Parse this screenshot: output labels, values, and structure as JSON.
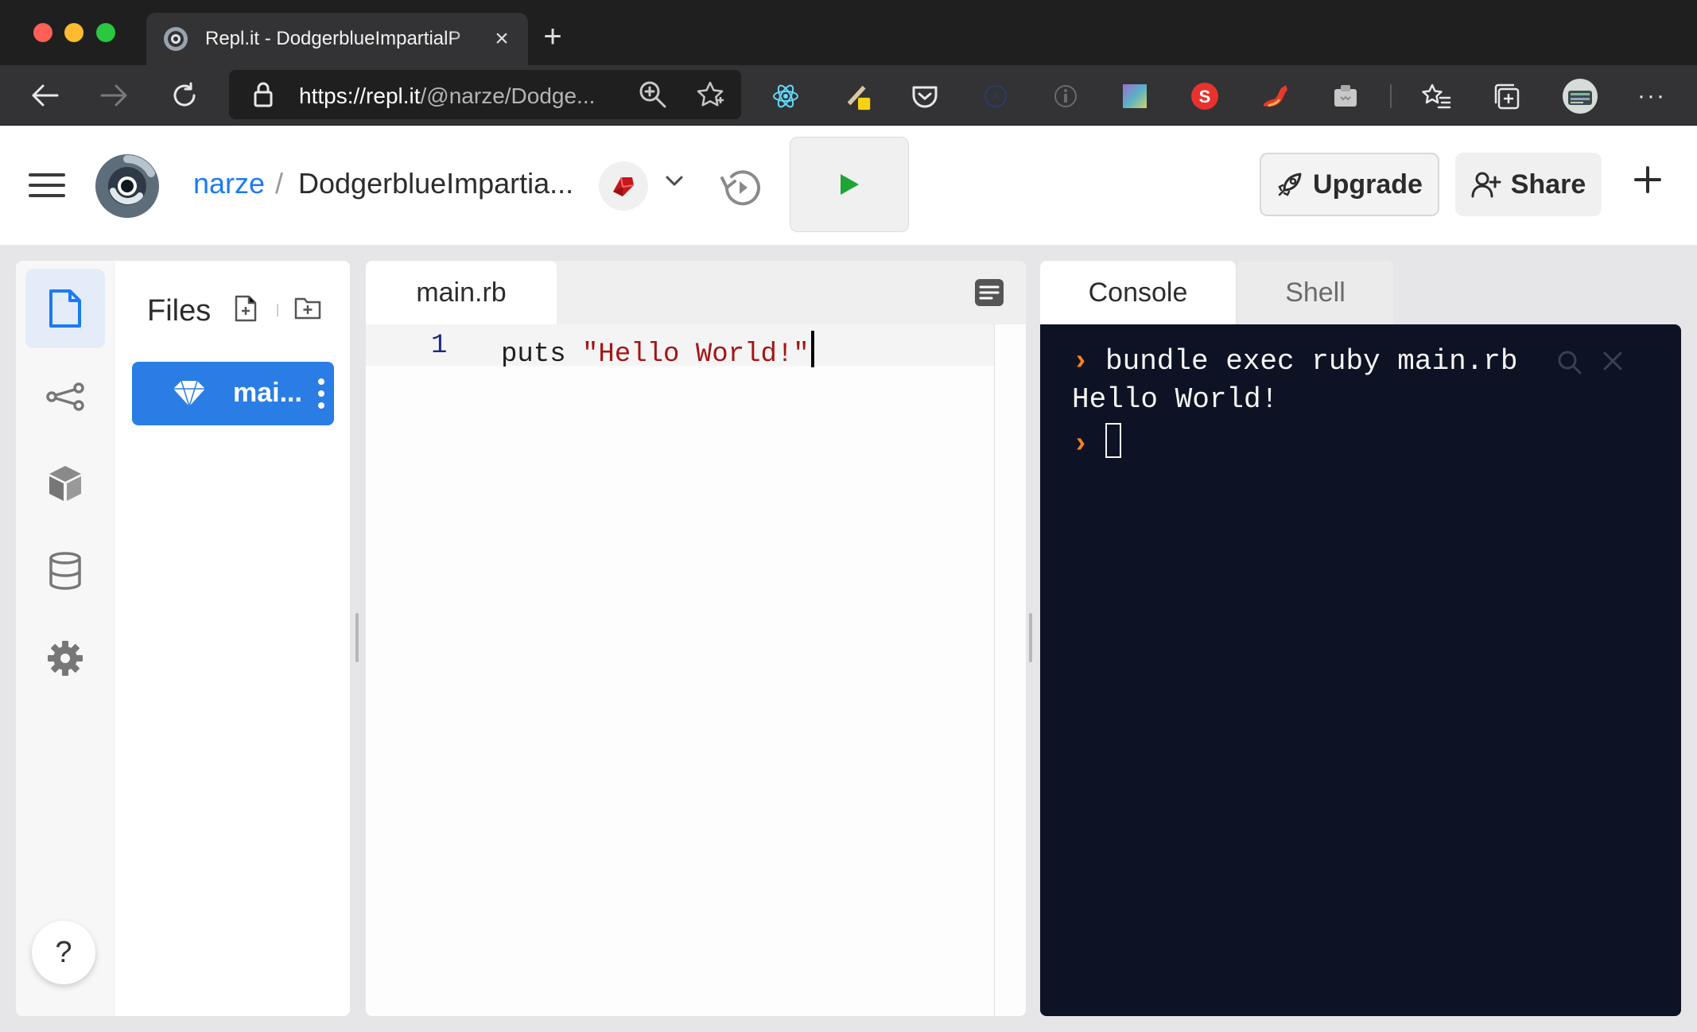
{
  "browser": {
    "tab_title": "Repl.it - DodgerblueImpartialP",
    "url_host": "https://repl.it",
    "url_path": "/@narze/Dodge...",
    "colors": {
      "chrome_dark": "#1f1f1f",
      "chrome_bar": "#333335"
    }
  },
  "header": {
    "username": "narze",
    "separator": "/",
    "repl_name": "DodgerblueImpartia...",
    "upgrade_label": "Upgrade",
    "share_label": "Share",
    "accent": "#1b7bf4"
  },
  "files": {
    "title": "Files",
    "items": [
      {
        "name": "mai..."
      }
    ]
  },
  "editor": {
    "tab": "main.rb",
    "lines": [
      {
        "number": "1",
        "keyword": "puts",
        "string": "\"Hello World!\""
      }
    ]
  },
  "console": {
    "tabs": [
      "Console",
      "Shell"
    ],
    "prompt": "›",
    "command": "bundle exec ruby main.rb",
    "output": "Hello World!",
    "background": "#0e1225"
  },
  "help": {
    "label": "?"
  }
}
